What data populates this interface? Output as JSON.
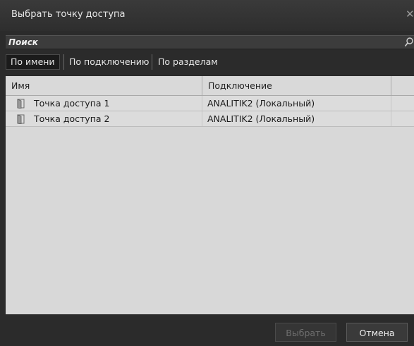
{
  "window": {
    "title": "Выбрать точку доступа"
  },
  "search": {
    "placeholder": "Поиск"
  },
  "tabs": [
    {
      "label": "По имени",
      "active": true
    },
    {
      "label": "По подключению",
      "active": false
    },
    {
      "label": "По разделам",
      "active": false
    }
  ],
  "table": {
    "columns": [
      "Имя",
      "Подключение"
    ],
    "rows": [
      {
        "name": "Точка доступа 1",
        "connection": "ANALITIK2 (Локальный)",
        "icon": "door-icon"
      },
      {
        "name": "Точка доступа 2",
        "connection": "ANALITIK2 (Локальный)",
        "icon": "door-icon"
      }
    ]
  },
  "buttons": {
    "select": "Выбрать",
    "cancel": "Отмена",
    "select_enabled": false
  },
  "colors": {
    "background": "#2b2b2b",
    "grid": "#d8d8d8",
    "text_light": "#e6e6e6",
    "disabled": "#6e6e6e"
  }
}
